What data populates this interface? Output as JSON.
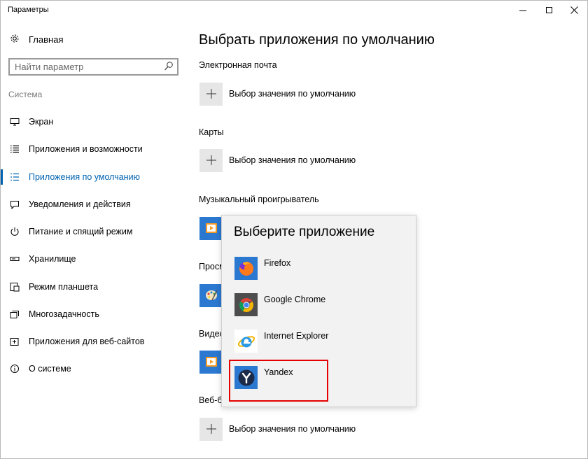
{
  "window": {
    "title": "Параметры"
  },
  "sidebar": {
    "home_label": "Главная",
    "search_placeholder": "Найти параметр",
    "section_title": "Система",
    "items": [
      {
        "label": "Экран",
        "icon": "display-icon"
      },
      {
        "label": "Приложения и возможности",
        "icon": "list-icon"
      },
      {
        "label": "Приложения по умолчанию",
        "icon": "default-apps-icon",
        "active": true
      },
      {
        "label": "Уведомления и действия",
        "icon": "notification-icon"
      },
      {
        "label": "Питание и спящий режим",
        "icon": "power-icon"
      },
      {
        "label": "Хранилище",
        "icon": "storage-icon"
      },
      {
        "label": "Режим планшета",
        "icon": "tablet-icon"
      },
      {
        "label": "Многозадачность",
        "icon": "multitask-icon"
      },
      {
        "label": "Приложения для веб-сайтов",
        "icon": "web-apps-icon"
      },
      {
        "label": "О системе",
        "icon": "info-icon"
      }
    ]
  },
  "main": {
    "title": "Выбрать приложения по умолчанию",
    "categories": [
      {
        "label": "Электронная почта",
        "value": "Выбор значения по умолчанию"
      },
      {
        "label": "Карты",
        "value": "Выбор значения по умолчанию"
      },
      {
        "label": "Музыкальный проигрыватель",
        "value": ""
      },
      {
        "label": "Просм",
        "value": ""
      },
      {
        "label": "Видео",
        "value": ""
      },
      {
        "label": "Веб-б",
        "value": "Выбор значения по умолчанию"
      }
    ]
  },
  "popup": {
    "title": "Выберите приложение",
    "apps": [
      {
        "name": "Firefox",
        "icon": "firefox-icon"
      },
      {
        "name": "Google Chrome",
        "icon": "chrome-icon"
      },
      {
        "name": "Internet Explorer",
        "icon": "internet-explorer-icon"
      },
      {
        "name": "Yandex",
        "icon": "yandex-icon",
        "highlighted": true
      }
    ]
  },
  "colors": {
    "accent": "#0063b1",
    "highlight": "#e50000",
    "tile_blue": "#2b78d0"
  }
}
